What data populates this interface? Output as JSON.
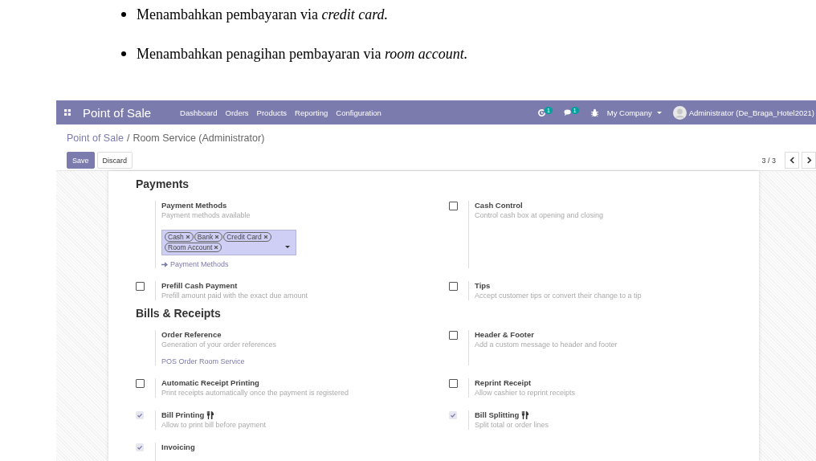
{
  "document": {
    "bullets": [
      "Menambahkan pembayaran via *credit card.*",
      "Menambahkan penagihan pembayaran via *room account.*"
    ]
  },
  "navbar": {
    "app_title": "Point of Sale",
    "menu": [
      "Dashboard",
      "Orders",
      "Products",
      "Reporting",
      "Configuration"
    ],
    "activity_badge": "1",
    "message_badge": "1",
    "company": "My Company",
    "user": "Administrator (De_Braga_Hotel2021)"
  },
  "control_panel": {
    "breadcrumb_parent": "Point of Sale",
    "breadcrumb_separator": "/",
    "breadcrumb_current": "Room Service (Administrator)",
    "buttons": [
      "Save",
      "Discard"
    ],
    "pager": "3 / 3"
  },
  "sections": [
    {
      "title": "Payments",
      "settings": [
        {
          "kind": "field",
          "label": "Payment Methods",
          "description": "Payment methods available",
          "tags": [
            "Cash",
            "Bank",
            "Credit Card",
            "Room Account"
          ],
          "link": "Payment Methods"
        },
        {
          "kind": "checkbox",
          "checked": false,
          "disabled": false,
          "label": "Cash Control",
          "description": "Control cash box at opening and closing"
        },
        {
          "kind": "checkbox",
          "checked": false,
          "disabled": false,
          "label": "Prefill Cash Payment",
          "description": "Prefill amount paid with the exact due amount"
        },
        {
          "kind": "checkbox",
          "checked": false,
          "disabled": false,
          "label": "Tips",
          "description": "Accept customer tips or convert their change to a tip"
        }
      ]
    },
    {
      "title": "Bills & Receipts",
      "settings": [
        {
          "kind": "value",
          "label": "Order Reference",
          "description": "Generation of your order references",
          "value": "POS Order Room Service"
        },
        {
          "kind": "checkbox",
          "checked": false,
          "disabled": false,
          "label": "Header & Footer",
          "description": "Add a custom message to header and footer"
        },
        {
          "kind": "checkbox",
          "checked": false,
          "disabled": false,
          "label": "Automatic Receipt Printing",
          "description": "Print receipts automatically once the payment is registered"
        },
        {
          "kind": "checkbox",
          "checked": false,
          "disabled": false,
          "label": "Reprint Receipt",
          "description": "Allow cashier to reprint receipts"
        },
        {
          "kind": "checkbox",
          "checked": true,
          "disabled": true,
          "restaurant": true,
          "label": "Bill Printing",
          "description": "Allow to print bill before payment"
        },
        {
          "kind": "checkbox",
          "checked": true,
          "disabled": true,
          "restaurant": true,
          "label": "Bill Splitting",
          "description": "Split total or order lines"
        },
        {
          "kind": "checkbox",
          "checked": true,
          "disabled": true,
          "label": "Invoicing"
        }
      ]
    }
  ]
}
